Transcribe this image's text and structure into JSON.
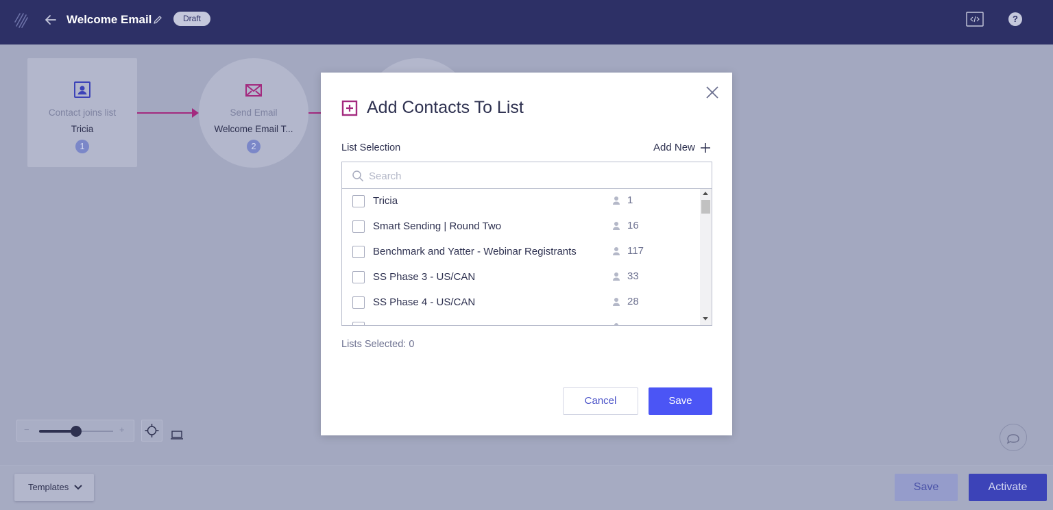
{
  "header": {
    "title": "Welcome Email",
    "status_badge": "Draft",
    "help_label": "?"
  },
  "workflow": {
    "nodes": [
      {
        "label": "Contact joins list",
        "sub": "Tricia",
        "step": "1",
        "icon": "contact-card-icon"
      },
      {
        "label": "Send Email",
        "sub": "Welcome Email T...",
        "step": "2",
        "icon": "envelope-icon"
      }
    ]
  },
  "zoom": {
    "minus_label": "−",
    "plus_label": "+",
    "level": 0.5
  },
  "footer": {
    "templates_label": "Templates",
    "save_label": "Save",
    "activate_label": "Activate"
  },
  "modal": {
    "title": "Add Contacts To List",
    "list_selection_label": "List Selection",
    "add_new_label": "Add New",
    "search_placeholder": "Search",
    "lists": [
      {
        "name": "Tricia",
        "count": "1"
      },
      {
        "name": "Smart Sending | Round Two",
        "count": "16"
      },
      {
        "name": "Benchmark and Yatter - Webinar Registrants",
        "count": "117"
      },
      {
        "name": "SS Phase 3 - US/CAN",
        "count": "33"
      },
      {
        "name": "SS Phase 4 - US/CAN",
        "count": "28"
      }
    ],
    "lists_selected_label": "Lists Selected: 0",
    "cancel_label": "Cancel",
    "save_label": "Save"
  },
  "colors": {
    "topbar": "#2d3066",
    "accent_magenta": "#a3297e",
    "primary_button": "#4b55f5",
    "activate_button": "#3c43b8"
  }
}
